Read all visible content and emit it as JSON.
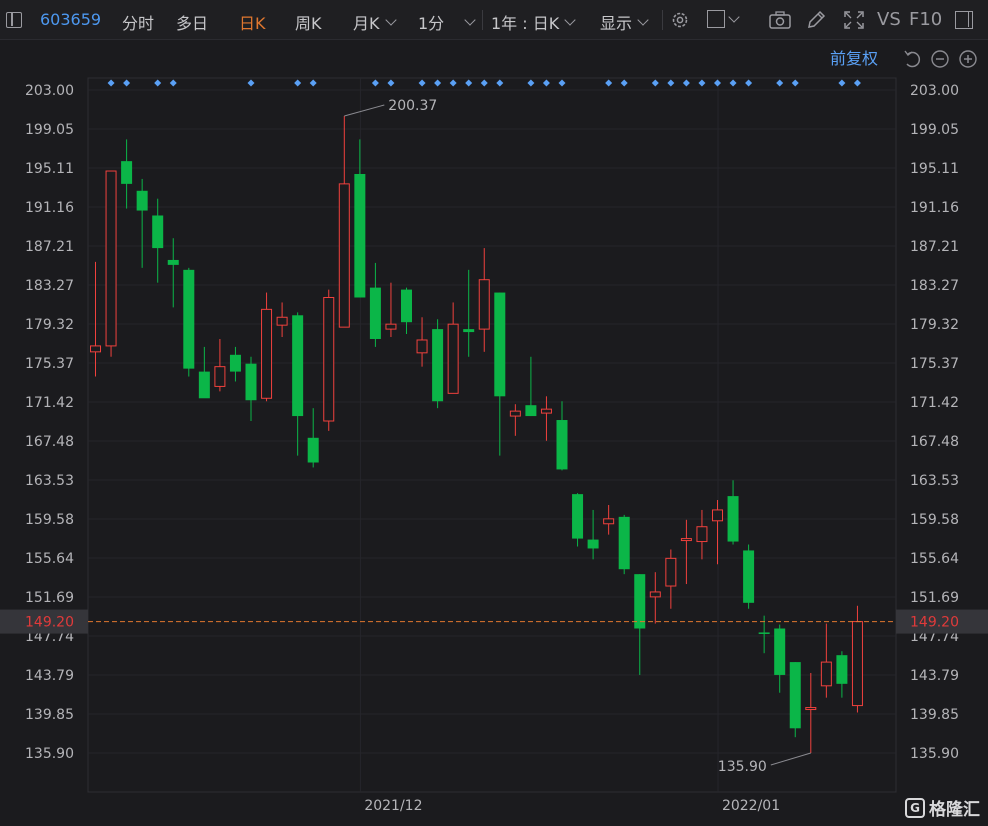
{
  "toolbar": {
    "stock_code": "603659",
    "tabs": [
      "分时",
      "多日",
      "日K",
      "周K",
      "月K",
      "1分"
    ],
    "active_tab": "日K",
    "range": "1年 : 日K",
    "display": "显示",
    "vs": "VS",
    "f10": "F10"
  },
  "adjust": {
    "label": "前复权"
  },
  "colors": {
    "up": "#f0413d",
    "down": "#0bb648",
    "accent": "#e0772f",
    "link": "#5aa0f5",
    "price_tag": "#e03a3a"
  },
  "watermark": {
    "text": "格隆汇"
  },
  "chart_data": {
    "type": "candlestick",
    "y_ticks": [
      "203.00",
      "199.05",
      "195.11",
      "191.16",
      "187.21",
      "183.27",
      "179.32",
      "175.37",
      "171.42",
      "167.48",
      "163.53",
      "159.58",
      "155.64",
      "151.69",
      "147.74",
      "143.79",
      "139.85",
      "135.90"
    ],
    "ylim": [
      135.9,
      203.0
    ],
    "x_labels": [
      {
        "text": "2021/12",
        "index": 18
      },
      {
        "text": "2022/01",
        "index": 41
      }
    ],
    "current_price": 149.2,
    "current_price_label": "149.20",
    "annotations": [
      {
        "text": "200.37",
        "index": 16,
        "value": 200.37,
        "side": "high"
      },
      {
        "text": "135.90",
        "index": 46,
        "value": 135.9,
        "side": "low"
      }
    ],
    "event_markers": [
      1,
      2,
      4,
      5,
      10,
      13,
      14,
      18,
      19,
      21,
      22,
      23,
      24,
      25,
      26,
      28,
      29,
      30,
      33,
      34,
      36,
      37,
      38,
      39,
      40,
      41,
      42,
      44,
      45,
      48,
      49
    ],
    "candles": [
      {
        "o": 176.5,
        "h": 185.6,
        "l": 174.0,
        "c": 177.1
      },
      {
        "o": 177.1,
        "h": 194.8,
        "l": 176.0,
        "c": 194.8
      },
      {
        "o": 195.8,
        "h": 198.0,
        "l": 191.0,
        "c": 193.5
      },
      {
        "o": 192.8,
        "h": 194.0,
        "l": 185.0,
        "c": 190.8
      },
      {
        "o": 190.3,
        "h": 192.0,
        "l": 183.5,
        "c": 187.0
      },
      {
        "o": 185.8,
        "h": 188.0,
        "l": 181.0,
        "c": 185.3
      },
      {
        "o": 184.8,
        "h": 185.0,
        "l": 174.0,
        "c": 174.8
      },
      {
        "o": 174.5,
        "h": 177.0,
        "l": 172.0,
        "c": 171.8
      },
      {
        "o": 173.0,
        "h": 177.8,
        "l": 172.5,
        "c": 175.0
      },
      {
        "o": 176.2,
        "h": 177.0,
        "l": 173.5,
        "c": 174.5
      },
      {
        "o": 175.3,
        "h": 176.0,
        "l": 169.5,
        "c": 171.6
      },
      {
        "o": 171.8,
        "h": 182.5,
        "l": 171.5,
        "c": 180.8
      },
      {
        "o": 179.2,
        "h": 181.5,
        "l": 178.0,
        "c": 180.0
      },
      {
        "o": 180.2,
        "h": 180.5,
        "l": 166.0,
        "c": 170.0
      },
      {
        "o": 167.8,
        "h": 170.8,
        "l": 164.8,
        "c": 165.3
      },
      {
        "o": 169.5,
        "h": 182.8,
        "l": 168.5,
        "c": 182.0
      },
      {
        "o": 179.0,
        "h": 200.37,
        "l": 179.0,
        "c": 193.5
      },
      {
        "o": 194.5,
        "h": 198.0,
        "l": 182.0,
        "c": 182.0
      },
      {
        "o": 183.0,
        "h": 185.5,
        "l": 177.0,
        "c": 177.8
      },
      {
        "o": 178.8,
        "h": 183.5,
        "l": 178.0,
        "c": 179.3
      },
      {
        "o": 182.8,
        "h": 183.0,
        "l": 178.3,
        "c": 179.5
      },
      {
        "o": 176.4,
        "h": 180.0,
        "l": 175.0,
        "c": 177.7
      },
      {
        "o": 178.8,
        "h": 179.8,
        "l": 170.8,
        "c": 171.5
      },
      {
        "o": 172.3,
        "h": 181.5,
        "l": 172.3,
        "c": 179.3
      },
      {
        "o": 178.8,
        "h": 184.8,
        "l": 176.0,
        "c": 178.5
      },
      {
        "o": 178.8,
        "h": 187.0,
        "l": 176.5,
        "c": 183.8
      },
      {
        "o": 182.5,
        "h": 182.5,
        "l": 166.0,
        "c": 172.0
      },
      {
        "o": 170.0,
        "h": 171.2,
        "l": 168.0,
        "c": 170.5
      },
      {
        "o": 171.1,
        "h": 176.0,
        "l": 170.0,
        "c": 170.0
      },
      {
        "o": 170.3,
        "h": 172.0,
        "l": 167.5,
        "c": 170.7
      },
      {
        "o": 169.6,
        "h": 171.5,
        "l": 164.5,
        "c": 164.6
      },
      {
        "o": 162.1,
        "h": 162.2,
        "l": 156.8,
        "c": 157.6
      },
      {
        "o": 157.5,
        "h": 160.5,
        "l": 155.5,
        "c": 156.6
      },
      {
        "o": 159.1,
        "h": 161.0,
        "l": 158.0,
        "c": 159.6
      },
      {
        "o": 159.8,
        "h": 160.0,
        "l": 154.0,
        "c": 154.5
      },
      {
        "o": 154.0,
        "h": 154.0,
        "l": 143.8,
        "c": 148.5
      },
      {
        "o": 151.7,
        "h": 154.2,
        "l": 149.0,
        "c": 152.2
      },
      {
        "o": 152.8,
        "h": 156.5,
        "l": 150.5,
        "c": 155.6
      },
      {
        "o": 157.4,
        "h": 159.5,
        "l": 153.0,
        "c": 157.6
      },
      {
        "o": 157.3,
        "h": 160.5,
        "l": 155.5,
        "c": 158.8
      },
      {
        "o": 159.4,
        "h": 161.5,
        "l": 155.0,
        "c": 160.5
      },
      {
        "o": 161.9,
        "h": 163.5,
        "l": 157.0,
        "c": 157.3
      },
      {
        "o": 156.4,
        "h": 157.0,
        "l": 150.5,
        "c": 151.1
      },
      {
        "o": 148.1,
        "h": 149.8,
        "l": 146.0,
        "c": 148.0
      },
      {
        "o": 148.5,
        "h": 148.9,
        "l": 142.0,
        "c": 143.8
      },
      {
        "o": 145.1,
        "h": 145.1,
        "l": 137.5,
        "c": 138.4
      },
      {
        "o": 140.3,
        "h": 144.0,
        "l": 135.9,
        "c": 140.5
      },
      {
        "o": 142.7,
        "h": 149.0,
        "l": 141.5,
        "c": 145.1
      },
      {
        "o": 145.8,
        "h": 146.2,
        "l": 141.5,
        "c": 142.9
      },
      {
        "o": 140.7,
        "h": 150.8,
        "l": 140.0,
        "c": 149.2
      }
    ]
  }
}
